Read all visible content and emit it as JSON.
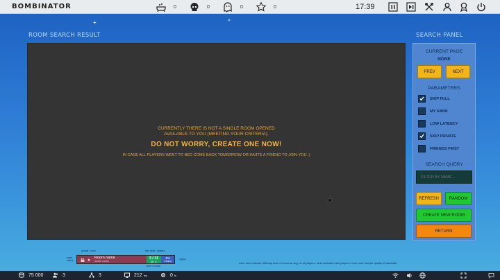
{
  "app": {
    "title": "BOMBINATOR"
  },
  "topbar": {
    "stats": [
      {
        "icon": "bathtub-icon",
        "value": "0"
      },
      {
        "icon": "skull-icon",
        "value": "0"
      },
      {
        "icon": "ghost-icon",
        "value": "0"
      },
      {
        "icon": "star-icon",
        "value": "0"
      }
    ],
    "clock": "17:39",
    "buttons": [
      "pause-icon",
      "exit-icon",
      "tools-icon",
      "user-icon",
      "ribbon-icon",
      "power-icon"
    ]
  },
  "room_search": {
    "title": "ROOM SEARCH RESULT",
    "message_line1a": "CURRENTLY THERE IS NOT A SINGLE ROOM OPENED",
    "message_line1b": "AVAILABLE TO YOU (MEETING YOUR CRITERIA).",
    "message_headline": "DO NOT WORRY, CREATE ONE NOW!",
    "message_line3": "IN CASE ALL PLAYERS WENT TO BED COME BACK TOMORROW OR INVITE A FRIEND TO JOIN YOU :)"
  },
  "panel": {
    "title": "SEARCH PANEL",
    "current_page_label": "CURRENT PAGE",
    "current_page_value": "NONE",
    "prev_label": "PREV",
    "next_label": "NEXT",
    "parameters_label": "PARAMETERS",
    "parameters": [
      {
        "label": "SKIP FULL",
        "checked": true
      },
      {
        "label": "MY RANK",
        "checked": false
      },
      {
        "label": "LOW LATENCY",
        "checked": false
      },
      {
        "label": "SKIP PRIVATE",
        "checked": true
      },
      {
        "label": "FRIENDS FIRST",
        "checked": false
      }
    ],
    "search_query_label": "SEARCH QUERY",
    "search_placeholder": "FILTER BY NAME...",
    "refresh_label": "REFRESH",
    "random_label": "RANDOM",
    "create_label": "CREATE NEW ROOM",
    "return_label": "RETURN"
  },
  "legend": {
    "private_open": "private / open",
    "room_status": "room status",
    "free_players": "free slots / players",
    "room_name": "Room name",
    "owner_name": "owner name",
    "slots": "3 / 11",
    "mode": "M / C",
    "region_code": "EU",
    "region_sub": "Poland",
    "region_label": "region",
    "level_shown": "level / shown",
    "note": "color bars indicate difficulty level of room as avg. of all players; rank indicates best player in room and last the quality of bandwith."
  },
  "bottombar": {
    "coins": "75 000",
    "players": "3",
    "rooms": "3",
    "ping": "212",
    "ping_unit": "ms",
    "fps": "0",
    "fps_unit": "fs"
  }
}
